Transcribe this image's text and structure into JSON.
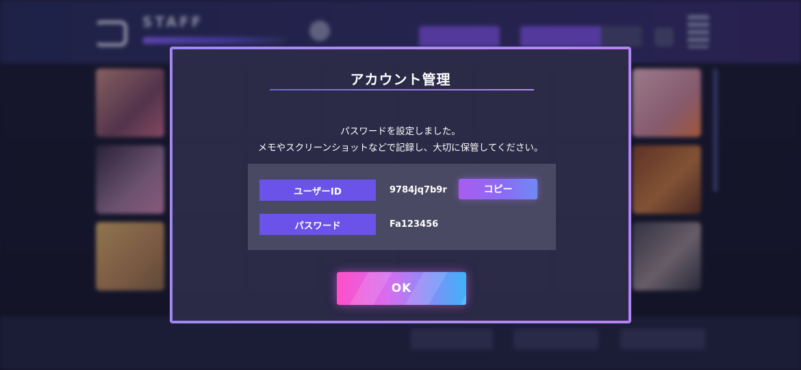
{
  "background": {
    "header_title": "STAFF"
  },
  "dialog": {
    "title": "アカウント管理",
    "message_line1": "パスワードを設定しました。",
    "message_line2": "メモやスクリーンショットなどで記録し、大切に保管してください。",
    "user_id_label": "ユーザーID",
    "user_id_value": "9784jq7b9r",
    "copy_label": "コピー",
    "password_label": "パスワード",
    "password_value": "Fa123456",
    "ok_label": "OK"
  },
  "colors": {
    "dialog_border": "#a78cf0",
    "label_bg": "#6b52e8",
    "ok_gradient_start": "#ff4fc8",
    "ok_gradient_end": "#3fb2f8"
  }
}
